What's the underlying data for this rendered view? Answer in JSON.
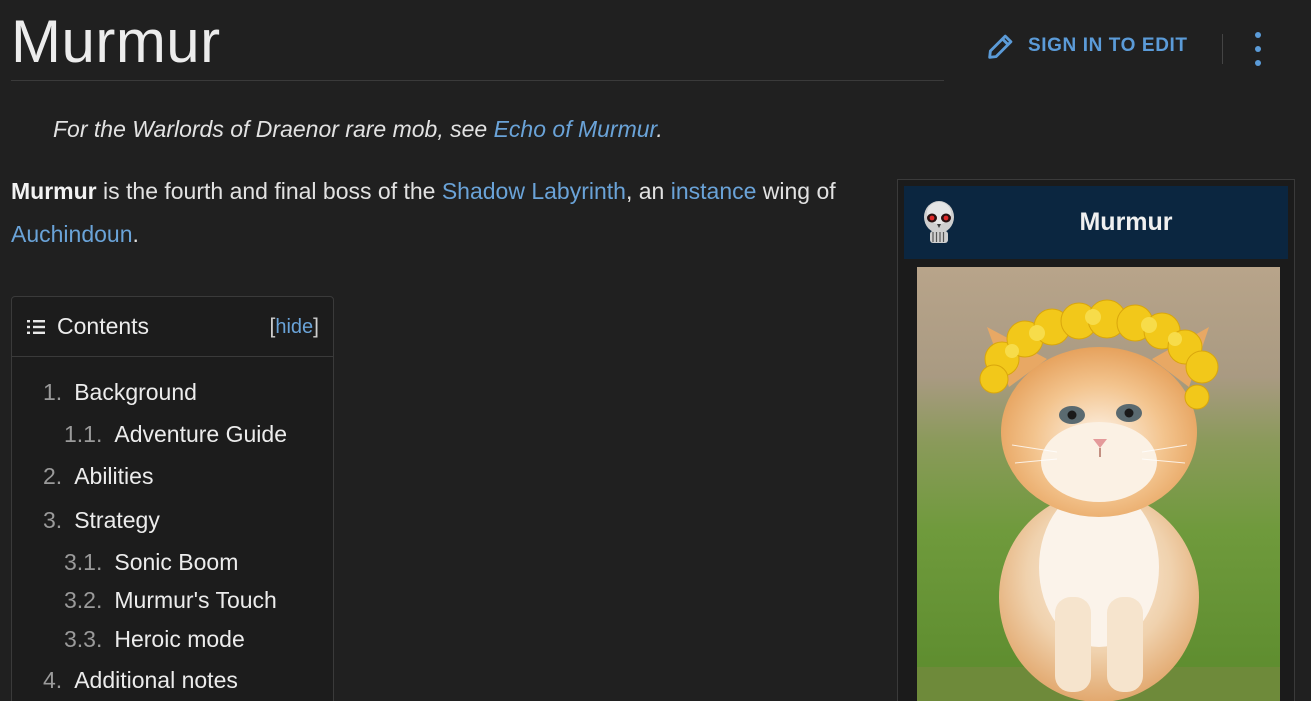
{
  "page": {
    "title": "Murmur",
    "edit_label": "SIGN IN TO EDIT"
  },
  "hatnote": {
    "prefix": "For the Warlords of Draenor rare mob, see ",
    "link": "Echo of Murmur",
    "suffix": "."
  },
  "intro": {
    "subject": "Murmur",
    "text1": " is the fourth and final boss of the ",
    "link1": "Shadow Labyrinth",
    "text2": ", an ",
    "link2": "instance",
    "text3": " wing of ",
    "link3": "Auchindoun",
    "text4": "."
  },
  "toc": {
    "title": "Contents",
    "hide_open": "[",
    "hide_label": "hide",
    "hide_close": "]",
    "items": [
      {
        "num": "1.",
        "label": "Background"
      },
      {
        "num": "1.1.",
        "label": "Adventure Guide"
      },
      {
        "num": "2.",
        "label": "Abilities"
      },
      {
        "num": "3.",
        "label": "Strategy"
      },
      {
        "num": "3.1.",
        "label": "Sonic Boom"
      },
      {
        "num": "3.2.",
        "label": "Murmur's Touch"
      },
      {
        "num": "3.3.",
        "label": "Heroic mode"
      },
      {
        "num": "4.",
        "label": "Additional notes"
      }
    ]
  },
  "infobox": {
    "title": "Murmur",
    "header_color": "#0b2640"
  },
  "colors": {
    "background": "#202020",
    "link": "#6aa3d8",
    "accent": "#5b9bd8"
  }
}
